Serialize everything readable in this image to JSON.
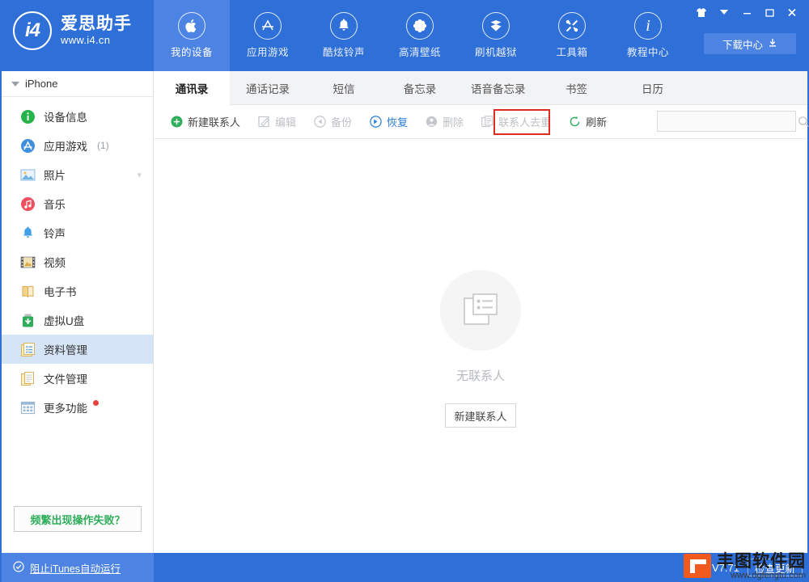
{
  "app": {
    "logo_title": "爱思助手",
    "logo_sub": "www.i4.cn",
    "logo_mark": "i4"
  },
  "titlebar": {
    "buttons": [
      {
        "name": "skin-icon",
        "label": "皮肤"
      },
      {
        "name": "menu-dropdown-icon",
        "label": "菜单"
      },
      {
        "name": "minimize-icon",
        "label": "最小化"
      },
      {
        "name": "maximize-icon",
        "label": "最大化"
      },
      {
        "name": "close-icon",
        "label": "关闭"
      }
    ],
    "download_label": "下载中心"
  },
  "topnav": {
    "items": [
      {
        "label": "我的设备",
        "icon": "apple-icon",
        "active": true
      },
      {
        "label": "应用游戏",
        "icon": "appstore-icon",
        "active": false
      },
      {
        "label": "酷炫铃声",
        "icon": "bell-icon",
        "active": false
      },
      {
        "label": "高清壁纸",
        "icon": "flower-icon",
        "active": false
      },
      {
        "label": "刷机越狱",
        "icon": "download-box-icon",
        "active": false
      },
      {
        "label": "工具箱",
        "icon": "tools-icon",
        "active": false
      },
      {
        "label": "教程中心",
        "icon": "info-italic-icon",
        "active": false
      }
    ]
  },
  "sidebar": {
    "device_name": "iPhone",
    "items": [
      {
        "label": "设备信息",
        "icon": "info-circle-icon",
        "count": "",
        "selected": false,
        "chevron": false,
        "dot": false
      },
      {
        "label": "应用游戏",
        "icon": "appstore-circle-icon",
        "count": "(1)",
        "selected": false,
        "chevron": false,
        "dot": false
      },
      {
        "label": "照片",
        "icon": "photo-icon",
        "count": "",
        "selected": false,
        "chevron": true,
        "dot": false
      },
      {
        "label": "音乐",
        "icon": "music-circle-icon",
        "count": "",
        "selected": false,
        "chevron": false,
        "dot": false
      },
      {
        "label": "铃声",
        "icon": "bell-blue-icon",
        "count": "",
        "selected": false,
        "chevron": false,
        "dot": false
      },
      {
        "label": "视频",
        "icon": "film-icon",
        "count": "",
        "selected": false,
        "chevron": false,
        "dot": false
      },
      {
        "label": "电子书",
        "icon": "book-icon",
        "count": "",
        "selected": false,
        "chevron": false,
        "dot": false
      },
      {
        "label": "虚拟U盘",
        "icon": "usb-icon",
        "count": "",
        "selected": false,
        "chevron": false,
        "dot": false
      },
      {
        "label": "资料管理",
        "icon": "data-card-icon",
        "count": "",
        "selected": true,
        "chevron": false,
        "dot": false
      },
      {
        "label": "文件管理",
        "icon": "file-copy-icon",
        "count": "",
        "selected": false,
        "chevron": false,
        "dot": false
      },
      {
        "label": "更多功能",
        "icon": "grid-icon",
        "count": "",
        "selected": false,
        "chevron": false,
        "dot": true
      }
    ],
    "help_label": "频繁出现操作失败？"
  },
  "tabs": [
    {
      "label": "通讯录",
      "active": true
    },
    {
      "label": "通话记录",
      "active": false
    },
    {
      "label": "短信",
      "active": false
    },
    {
      "label": "备忘录",
      "active": false
    },
    {
      "label": "语音备忘录",
      "active": false
    },
    {
      "label": "书签",
      "active": false
    },
    {
      "label": "日历",
      "active": false
    }
  ],
  "toolbar": {
    "buttons": [
      {
        "label": "新建联系人",
        "icon": "plus-circle-green-icon",
        "state": "enabled"
      },
      {
        "label": "编辑",
        "icon": "edit-icon",
        "state": "disabled"
      },
      {
        "label": "备份",
        "icon": "backup-icon",
        "state": "disabled"
      },
      {
        "label": "恢复",
        "icon": "restore-icon",
        "state": "accent"
      },
      {
        "label": "删除",
        "icon": "delete-icon",
        "state": "disabled"
      },
      {
        "label": "联系人去重",
        "icon": "dedupe-icon",
        "state": "disabled"
      },
      {
        "label": "刷新",
        "icon": "refresh-green-icon",
        "state": "enabled"
      }
    ],
    "highlight_target": "恢复",
    "highlight_color": "#e02b20"
  },
  "search": {
    "value": "",
    "placeholder": ""
  },
  "empty_state": {
    "icon": "contacts-card-icon",
    "text": "无联系人",
    "button_label": "新建联系人"
  },
  "statusbar": {
    "itunes_label": "阻止iTunes自动运行",
    "version": "V7.71",
    "update_label": "检查更新"
  },
  "watermark": {
    "title": "丰图软件园",
    "url": "www.dgfengtu.com"
  },
  "colors": {
    "brand_blue": "#2f6fd8",
    "brand_blue_light": "#4d83e3",
    "accent_blue": "#2b7cd3",
    "green": "#2eae5a",
    "highlight_red": "#e02b20",
    "selected_row": "#d6e4f7"
  }
}
